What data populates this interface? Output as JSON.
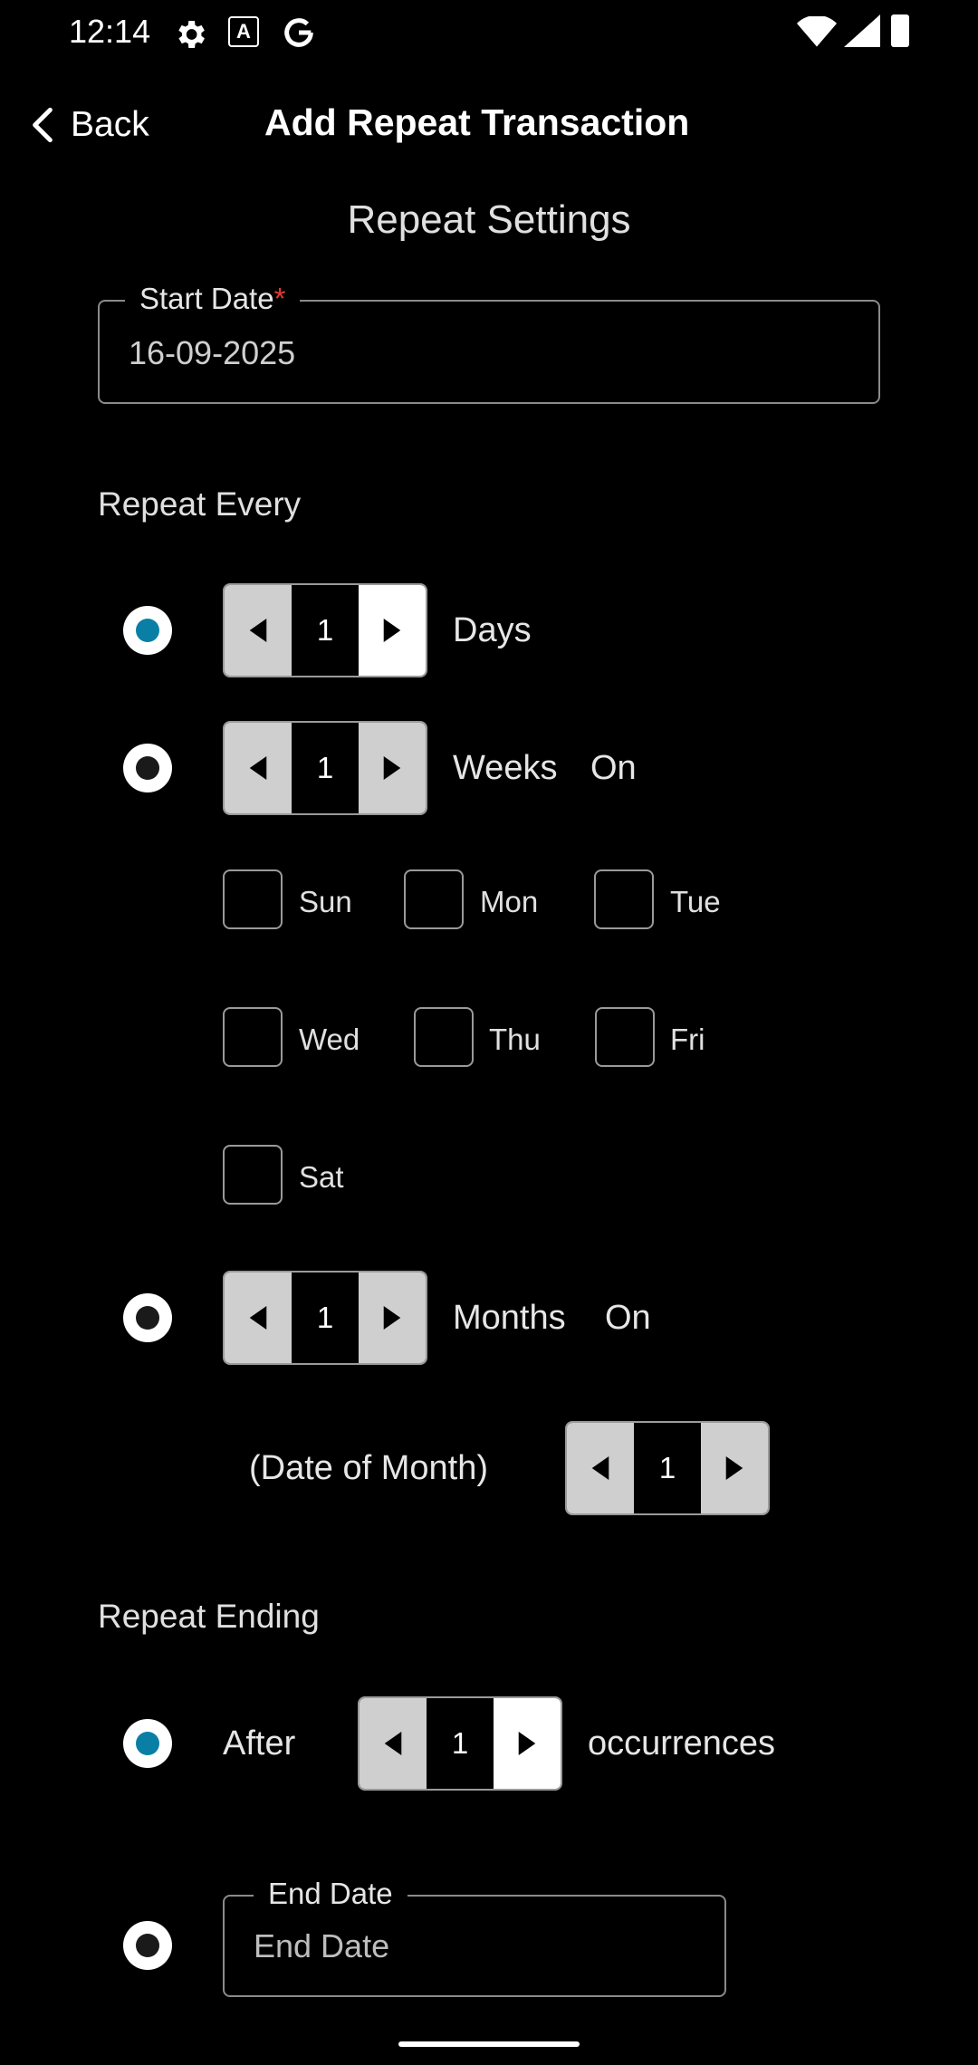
{
  "status_bar": {
    "time": "12:14",
    "icons_left": [
      "gear-icon",
      "a-icon",
      "g-icon"
    ],
    "icons_right": [
      "wifi-icon",
      "signal-icon",
      "battery-icon"
    ]
  },
  "header": {
    "back_label": "Back",
    "title": "Add Repeat Transaction"
  },
  "repeat_settings": {
    "title": "Repeat Settings",
    "start_date": {
      "label": "Start Date",
      "required_mark": "*",
      "value": "16-09-2025"
    }
  },
  "repeat_every": {
    "heading": "Repeat Every",
    "days": {
      "selected": true,
      "value": "1",
      "label": "Days"
    },
    "weeks": {
      "selected": false,
      "value": "1",
      "label": "Weeks",
      "on_label": "On"
    },
    "weekdays": [
      "Sun",
      "Mon",
      "Tue",
      "Wed",
      "Thu",
      "Fri",
      "Sat"
    ],
    "months": {
      "selected": false,
      "value": "1",
      "label": "Months",
      "on_label": "On"
    },
    "date_of_month": {
      "label": "(Date of Month)",
      "value": "1"
    }
  },
  "repeat_ending": {
    "heading": "Repeat Ending",
    "after": {
      "selected": true,
      "label": "After",
      "value": "1",
      "suffix": "occurrences"
    },
    "end_date": {
      "selected": false,
      "label": "End Date",
      "placeholder": "End Date"
    }
  },
  "colors": {
    "background": "#000000",
    "accent": "#0a7fa6",
    "required": "#e53935"
  }
}
